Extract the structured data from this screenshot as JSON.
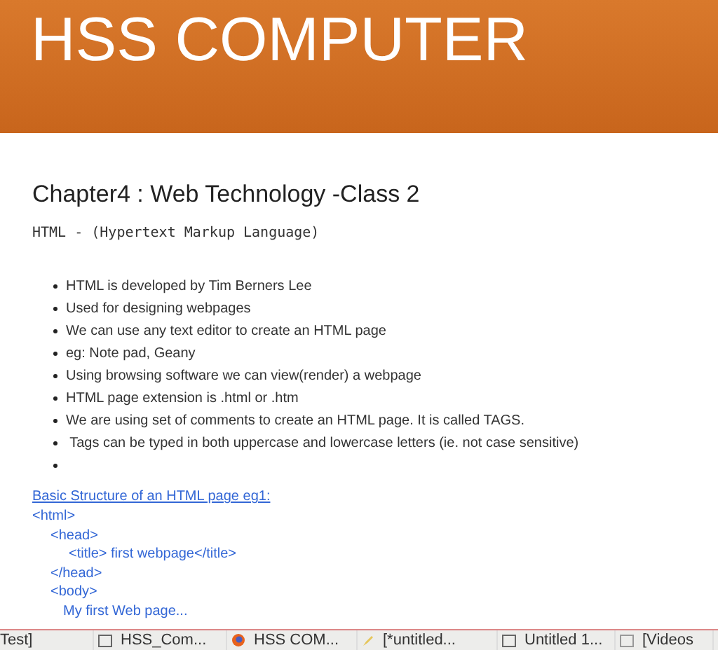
{
  "header": {
    "title": "HSS COMPUTER"
  },
  "post": {
    "title": "Chapter4 : Web Technology -Class 2",
    "subtitle": "HTML - (Hypertext Markup Language)",
    "bullets": [
      "HTML is developed by Tim Berners Lee",
      "Used for designing webpages",
      "We can use any text editor to create an HTML page",
      "eg: Note pad, Geany",
      "Using browsing software we can view(render) a webpage",
      "HTML page extension is .html or .htm",
      "We are using set of comments to create an HTML page. It is called TAGS.",
      " Tags can be typed in both uppercase and lowercase letters (ie. not case sensitive)"
    ],
    "empty_bullet_after": true,
    "link": "Basic Structure of an HTML page eg1:",
    "code_lines": [
      {
        "text": "<html>",
        "children": [
          {
            "text": "<head>",
            "children": [
              {
                "text": "<title> first webpage</title>"
              }
            ]
          },
          {
            "text": "</head>"
          },
          {
            "text": "<body>",
            "children": [
              {
                "text": "My first Web page..."
              }
            ]
          }
        ]
      }
    ]
  },
  "taskbar": {
    "items": [
      {
        "kind": "plain",
        "label": "Test]"
      },
      {
        "kind": "window",
        "label": "HSS_Com..."
      },
      {
        "kind": "browser",
        "label": "HSS COM..."
      },
      {
        "kind": "editor",
        "label": "[*untitled..."
      },
      {
        "kind": "window",
        "label": "Untitled 1..."
      },
      {
        "kind": "folder",
        "label": "[Videos"
      }
    ]
  }
}
